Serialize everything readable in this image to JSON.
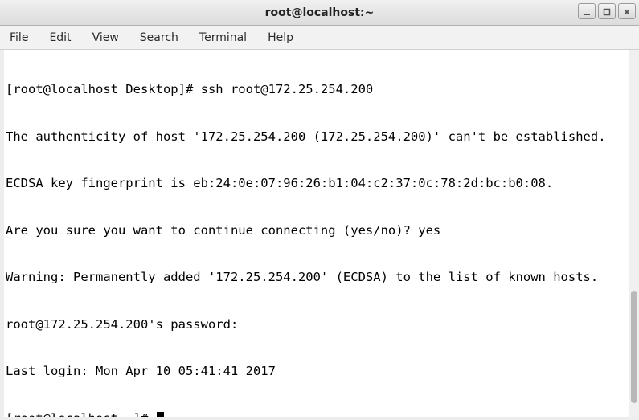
{
  "window": {
    "title": "root@localhost:~"
  },
  "menubar": {
    "items": [
      "File",
      "Edit",
      "View",
      "Search",
      "Terminal",
      "Help"
    ]
  },
  "terminal": {
    "lines": [
      "[root@localhost Desktop]# ssh root@172.25.254.200",
      "The authenticity of host '172.25.254.200 (172.25.254.200)' can't be established.",
      "ECDSA key fingerprint is eb:24:0e:07:96:26:b1:04:c2:37:0c:78:2d:bc:b0:08.",
      "Are you sure you want to continue connecting (yes/no)? yes",
      "Warning: Permanently added '172.25.254.200' (ECDSA) to the list of known hosts.",
      "root@172.25.254.200's password:",
      "Last login: Mon Apr 10 05:41:41 2017"
    ],
    "prompt": "[root@localhost ~]# "
  }
}
